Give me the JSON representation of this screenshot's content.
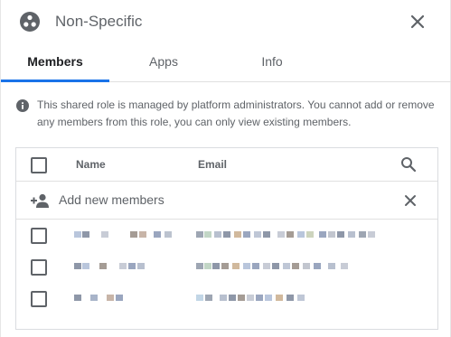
{
  "header": {
    "title": "Non-Specific"
  },
  "tabs": [
    {
      "label": "Members",
      "active": true
    },
    {
      "label": "Apps",
      "active": false
    },
    {
      "label": "Info",
      "active": false
    }
  ],
  "notice": {
    "text": "This shared role is managed by platform administrators. You cannot add or remove any members from this role, you can only view existing members."
  },
  "table": {
    "columns": {
      "name": "Name",
      "email": "Email"
    },
    "add_placeholder": "Add new members",
    "rows": [
      {
        "name": "",
        "email": "",
        "redacted": true
      },
      {
        "name": "",
        "email": "",
        "redacted": true
      },
      {
        "name": "",
        "email": "",
        "redacted": true
      }
    ]
  },
  "colors": {
    "accent": "#1a73e8",
    "text_secondary": "#5f6368",
    "border": "#dadce0"
  },
  "icons": [
    "role-icon",
    "close-icon",
    "info-icon",
    "search-icon",
    "add-person-icon",
    "clear-icon"
  ]
}
